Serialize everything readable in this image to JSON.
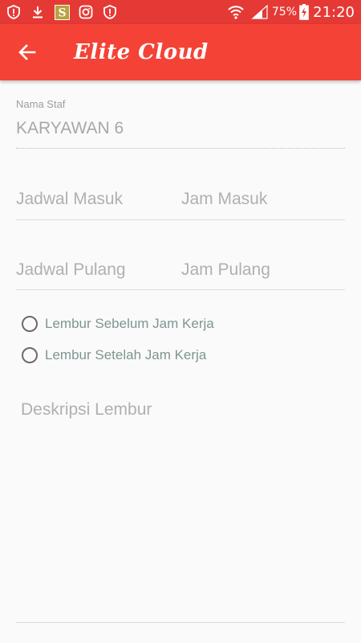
{
  "status_bar": {
    "time": "21:20",
    "battery_percent": "75%",
    "icons": [
      "alert-shield-icon",
      "download-icon",
      "s-app-icon",
      "instagram-icon",
      "alert-shield-icon",
      "wifi-icon",
      "signal-icon",
      "battery-charging-icon"
    ],
    "bg_color": "#e53935"
  },
  "app_bar": {
    "title": "Elite Cloud",
    "back_icon": "arrow-left-icon",
    "bg_color": "#f44336"
  },
  "form": {
    "staff_label": "Nama Staf",
    "staff_value": "KARYAWAN 6",
    "jadwal_masuk_placeholder": "Jadwal Masuk",
    "jam_masuk_placeholder": "Jam Masuk",
    "jadwal_pulang_placeholder": "Jadwal Pulang",
    "jam_pulang_placeholder": "Jam Pulang",
    "radio_options": [
      {
        "label": "Lembur Sebelum Jam Kerja",
        "selected": false
      },
      {
        "label": "Lembur Setelah Jam Kerja",
        "selected": false
      }
    ],
    "description_placeholder": "Deskripsi Lembur"
  }
}
